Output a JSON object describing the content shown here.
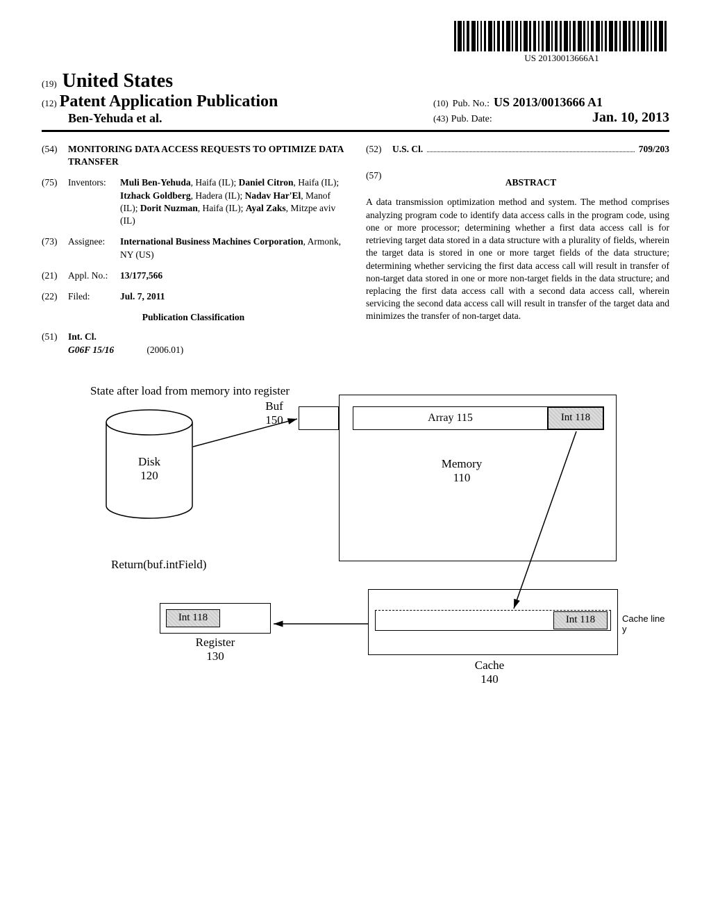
{
  "barcode_text": "US 20130013666A1",
  "code_19": "(19)",
  "country": "United States",
  "code_12": "(12)",
  "pub_title": "Patent Application Publication",
  "author_line": "Ben-Yehuda et al.",
  "code_10": "(10)",
  "pub_no_label": "Pub. No.:",
  "pub_no": "US 2013/0013666 A1",
  "code_43": "(43)",
  "pub_date_label": "Pub. Date:",
  "pub_date": "Jan. 10, 2013",
  "field_54_code": "(54)",
  "field_54_title": "MONITORING DATA ACCESS REQUESTS TO OPTIMIZE DATA TRANSFER",
  "field_75_code": "(75)",
  "field_75_label": "Inventors:",
  "field_75_body_html": "<b>Muli Ben-Yehuda</b>, Haifa (IL); <b>Daniel Citron</b>, Haifa (IL); <b>Itzhack Goldberg</b>, Hadera (IL); <b>Nadav Har'El</b>, Manof (IL); <b>Dorit Nuzman</b>, Haifa (IL); <b>Ayal Zaks</b>, Mitzpe aviv (IL)",
  "field_73_code": "(73)",
  "field_73_label": "Assignee:",
  "field_73_body_html": "<b>International Business Machines Corporation</b>, Armonk, NY (US)",
  "field_21_code": "(21)",
  "field_21_label": "Appl. No.:",
  "field_21_body": "13/177,566",
  "field_22_code": "(22)",
  "field_22_label": "Filed:",
  "field_22_body": "Jul. 7, 2011",
  "pub_class": "Publication Classification",
  "field_51_code": "(51)",
  "field_51_label": "Int. Cl.",
  "field_51_class": "G06F 15/16",
  "field_51_year": "(2006.01)",
  "field_52_code": "(52)",
  "field_52_label": "U.S. Cl.",
  "field_52_val": "709/203",
  "field_57_code": "(57)",
  "abstract_title": "ABSTRACT",
  "abstract_text": "A data transmission optimization method and system. The method comprises analyzing program code to identify data access calls in the program code, using one or more processor; determining whether a first data access call is for retrieving target data stored in a data structure with a plurality of fields, wherein the target data is stored in one or more target fields of the data structure; determining whether servicing the first data access call will result in transfer of non-target data stored in one or more non-target fields in the data structure; and replacing the first data access call with a second data access call, wherein servicing the second data access call will result in transfer of the target data and minimizes the transfer of non-target data.",
  "fig": {
    "caption": "State after load from memory into register",
    "disk": "Disk\n120",
    "buf": "Buf\n150",
    "array": "Array 115",
    "int": "Int 118",
    "memory": "Memory\n110",
    "return": "Return(buf.intField)",
    "register": "Register\n130",
    "cache": "Cache\n140",
    "cache_line": "Cache line y"
  }
}
